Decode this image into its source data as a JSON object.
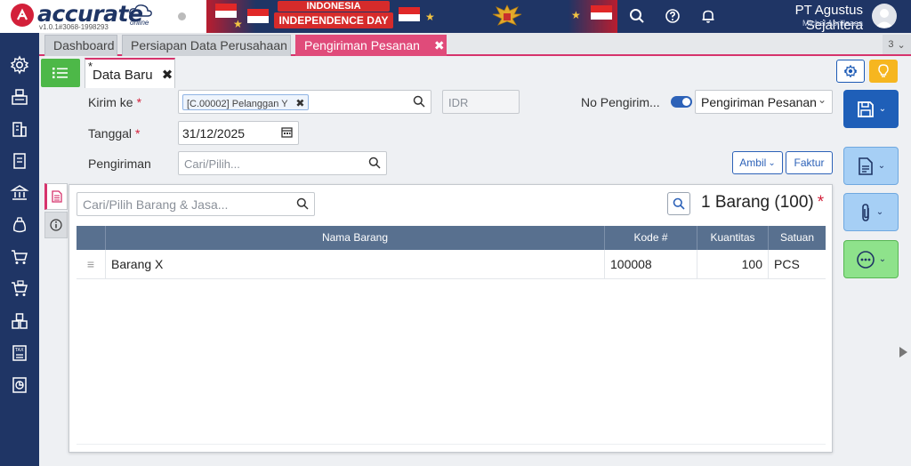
{
  "app": {
    "logo_text": "accurate",
    "logo_online": "online",
    "version": "v1.0.1#3068-1998293",
    "banner": {
      "line1": "INDONESIA",
      "line2": "INDEPENDENCE DAY"
    },
    "company": "PT Agustus Sejahtera",
    "user": "Michel Aprillaaaa"
  },
  "tabs": [
    {
      "label": "Dashboard"
    },
    {
      "label": "Persiapan Data Perusahaan"
    },
    {
      "label": "Pengiriman Pesanan",
      "close": "✖"
    }
  ],
  "tab_counter": "3",
  "sub_tab": {
    "star": "*",
    "label": "Data Baru",
    "close": "✖"
  },
  "form": {
    "kirim_ke_label": "Kirim ke",
    "required_mark": "*",
    "customer_chip": "[C.00002] Pelanggan Y",
    "chip_close": "✖",
    "currency": "IDR",
    "no_pengiriman_label": "No Pengirim...",
    "no_pengiriman_value": "Pengiriman Pesanan",
    "tanggal_label": "Tanggal",
    "tanggal_value": "31/12/2025",
    "pengiriman_label": "Pengiriman",
    "pengiriman_placeholder": "Cari/Pilih...",
    "ambil_label": "Ambil",
    "faktur_label": "Faktur"
  },
  "items": {
    "search_placeholder": "Cari/Pilih Barang & Jasa...",
    "count_label": "1 Barang (100)",
    "columns": [
      "Nama Barang",
      "Kode #",
      "Kuantitas",
      "Satuan"
    ],
    "rows": [
      {
        "name": "Barang X",
        "code": "100008",
        "qty": "100",
        "unit": "PCS"
      }
    ]
  },
  "colors": {
    "primary_navy": "#1f3565",
    "accent_pink": "#e04b7a",
    "green": "#4db848",
    "blue": "#1f5fb8",
    "grid_header": "#58708f",
    "required_red": "#d3203a"
  }
}
